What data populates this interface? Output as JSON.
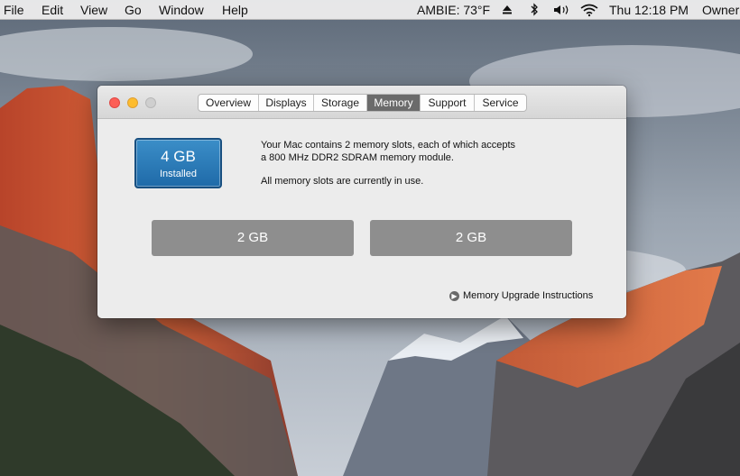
{
  "menubar": {
    "items": [
      "File",
      "Edit",
      "View",
      "Go",
      "Window",
      "Help"
    ],
    "status": {
      "ambie": "AMBIE: 73°F",
      "clock": "Thu 12:18 PM",
      "user": "Owner"
    },
    "icons": [
      "eject-icon",
      "bluetooth-icon",
      "volume-icon",
      "wifi-icon"
    ]
  },
  "window": {
    "tabs": [
      "Overview",
      "Displays",
      "Storage",
      "Memory",
      "Support",
      "Service"
    ],
    "active_tab": "Memory",
    "installed": {
      "size": "4 GB",
      "label": "Installed"
    },
    "description": {
      "line1": "Your Mac contains 2 memory slots, each of which accepts",
      "line2": "a 800 MHz DDR2 SDRAM memory module.",
      "line3": "All memory slots are currently in use."
    },
    "slots": [
      "2 GB",
      "2 GB"
    ],
    "upgrade_link": "Memory Upgrade Instructions"
  },
  "colors": {
    "accent_blue": "#2a7ab8",
    "slot_gray": "#8e8e8e",
    "close_red": "#fc5f57",
    "minimize_yellow": "#fdbc2e"
  }
}
